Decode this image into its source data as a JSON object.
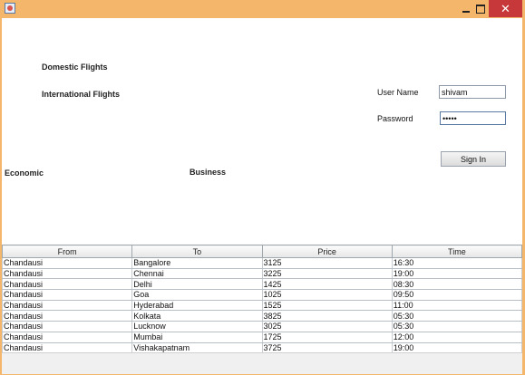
{
  "window": {
    "title": "",
    "close_glyph": "✕"
  },
  "nav": {
    "domestic": "Domestic Flights",
    "international": "International Flights"
  },
  "classes": {
    "economic": "Economic",
    "business": "Business"
  },
  "login": {
    "username_label": "User Name",
    "username_value": "shivam",
    "password_label": "Password",
    "password_value": "•••••",
    "signin_label": "Sign In"
  },
  "flights": {
    "columns": [
      "From",
      "To",
      "Price",
      "Time"
    ],
    "rows": [
      [
        "Chandausi",
        "Bangalore",
        "3125",
        "16:30"
      ],
      [
        "Chandausi",
        "Chennai",
        "3225",
        "19:00"
      ],
      [
        "Chandausi",
        "Delhi",
        "1425",
        "08:30"
      ],
      [
        "Chandausi",
        "Goa",
        "1025",
        "09:50"
      ],
      [
        "Chandausi",
        "Hyderabad",
        "1525",
        "11:00"
      ],
      [
        "Chandausi",
        "Kolkata",
        "3825",
        "05:30"
      ],
      [
        "Chandausi",
        "Lucknow",
        "3025",
        "05:30"
      ],
      [
        "Chandausi",
        "Mumbai",
        "1725",
        "12:00"
      ],
      [
        "Chandausi",
        "Vishakapatnam",
        "3725",
        "19:00"
      ]
    ]
  }
}
